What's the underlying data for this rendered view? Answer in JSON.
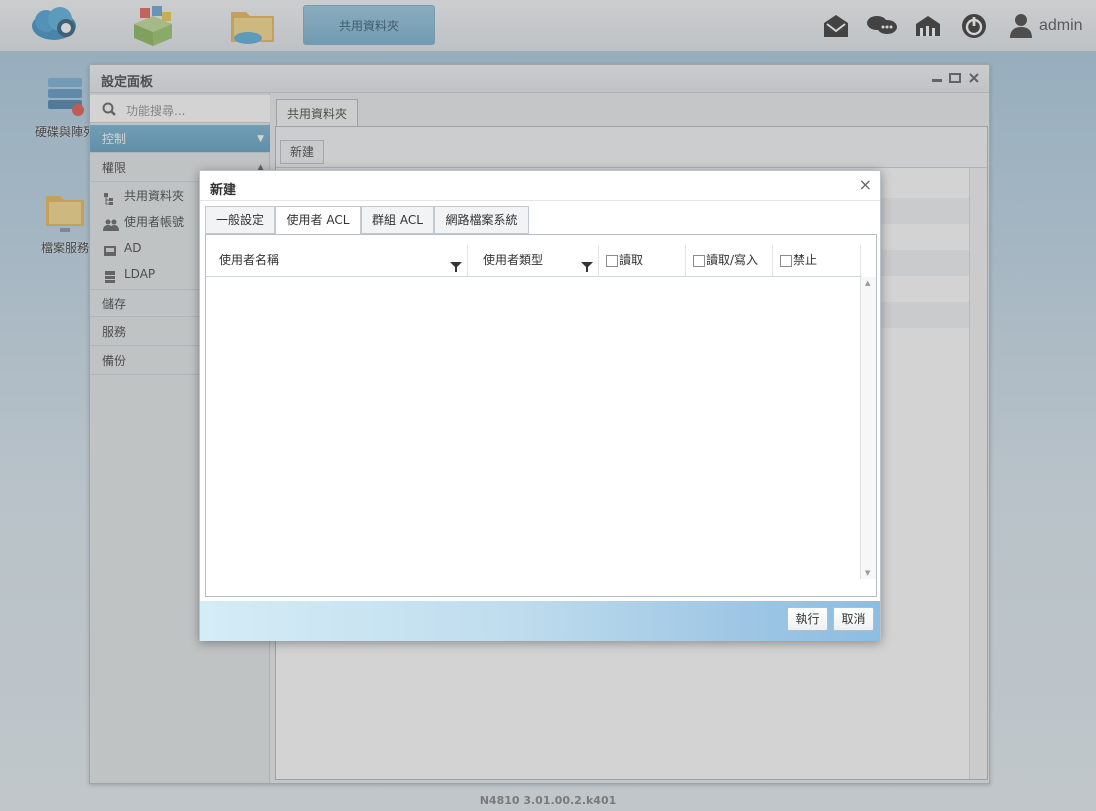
{
  "topbar": {
    "icons": [
      "cloud-icon",
      "app-center-icon",
      "file-manager-icon"
    ],
    "task_button_label": "共用資料夾",
    "tray_icons": [
      "mail-icon",
      "chat-icon",
      "network-icon",
      "power-icon",
      "user-icon"
    ],
    "user": "admin"
  },
  "desktop": {
    "icons": [
      {
        "label": "硬碟與陣列",
        "icon": "disk-raid-icon"
      },
      {
        "label": "檔案服務",
        "icon": "file-service-icon"
      }
    ]
  },
  "window": {
    "title": "設定面板",
    "controls": [
      "minimize-icon",
      "maximize-icon",
      "close-icon"
    ],
    "search_placeholder": "功能搜尋...",
    "categories": {
      "control": "控制",
      "permission": "權限",
      "storage": "儲存",
      "service": "服務",
      "backup": "備份"
    },
    "permission_items": [
      {
        "label": "共用資料夾",
        "icon": "share-folder-icon"
      },
      {
        "label": "使用者帳號",
        "icon": "users-icon"
      },
      {
        "label": "AD",
        "icon": "ad-icon"
      },
      {
        "label": "LDAP",
        "icon": "ldap-icon"
      }
    ],
    "main_tab": "共用資料夾",
    "new_button": "新建"
  },
  "dialog": {
    "title": "新建",
    "close": "×",
    "tabs": [
      "一般設定",
      "使用者 ACL",
      "群組 ACL",
      "網路檔案系統"
    ],
    "active_tab": "使用者 ACL",
    "columns": {
      "user_name": "使用者名稱",
      "user_type": "使用者類型",
      "read": "讀取",
      "read_write": "讀取/寫入",
      "deny": "禁止"
    },
    "buttons": {
      "apply": "執行",
      "cancel": "取消"
    }
  },
  "footer": {
    "version": "N4810   3.01.00.2.k401"
  },
  "colors": {
    "accent": "#4f97bf",
    "task_button": "#7ab5d5"
  }
}
